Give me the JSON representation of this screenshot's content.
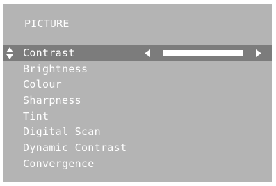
{
  "menu": {
    "title": "PICTURE",
    "selected_index": 0,
    "items": [
      {
        "label": "Contrast"
      },
      {
        "label": "Brightness"
      },
      {
        "label": "Colour"
      },
      {
        "label": "Sharpness"
      },
      {
        "label": "Tint"
      },
      {
        "label": "Digital Scan"
      },
      {
        "label": "Dynamic Contrast"
      },
      {
        "label": "Convergence"
      }
    ],
    "contrast_slider": {
      "level": 1.0,
      "left_icon": "triangle-left-icon",
      "right_icon": "triangle-right-icon",
      "nav_icon": "up-down-arrows-icon"
    }
  },
  "colors": {
    "panel": "#b4b4b4",
    "highlight": "#7c7c7c",
    "text": "#ffffff"
  }
}
